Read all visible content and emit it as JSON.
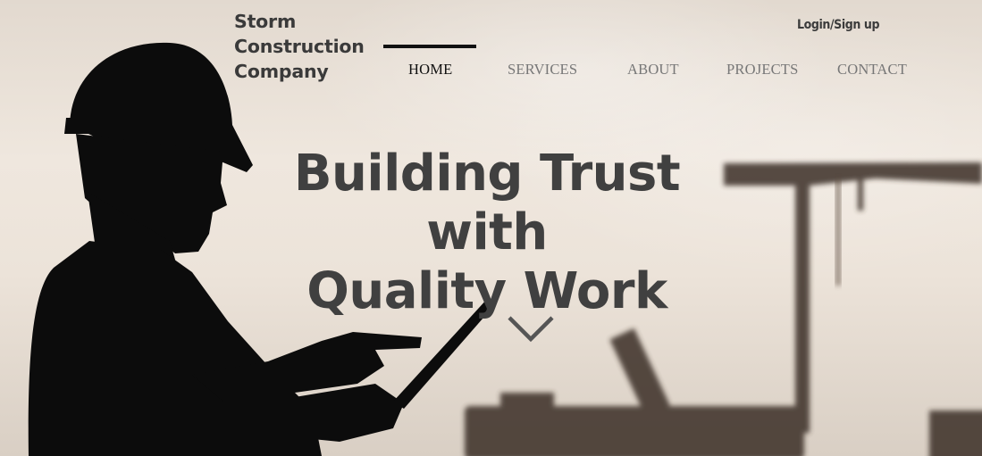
{
  "logo": {
    "line1": "Storm",
    "line2": "Construction",
    "line3": "Company"
  },
  "auth": {
    "label": "Login/Sign up"
  },
  "nav": {
    "active": "HOME",
    "items": [
      {
        "label": "HOME"
      },
      {
        "label": "SERVICES"
      },
      {
        "label": "ABOUT"
      },
      {
        "label": "PROJECTS"
      },
      {
        "label": "CONTACT"
      }
    ]
  },
  "hero": {
    "headline_line1": "Building Trust with",
    "headline_line2": "Quality Work",
    "scroll_icon": "chevron-down-icon"
  },
  "colors": {
    "text_dark": "#404040",
    "nav_inactive": "#777777",
    "nav_active": "#111111",
    "background": "#ece3d9"
  }
}
